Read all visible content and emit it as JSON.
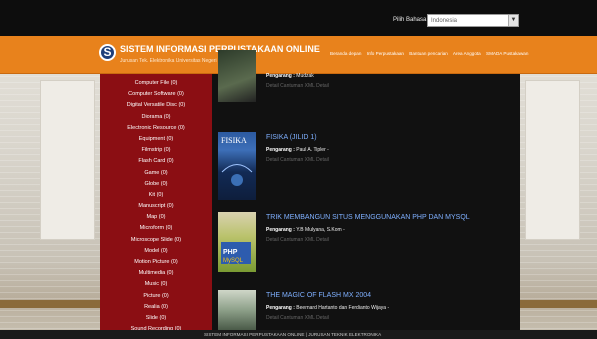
{
  "topbar": {
    "language_label": "Pilih Bahasa",
    "language_value": "Indonesia"
  },
  "header": {
    "title": "SISTEM INFORMASI PERPUSTAKAAN ONLINE",
    "subtitle": "Jurusan Tek. Elektronika Universitas Negeri Makassar",
    "nav": [
      "Beranda depan",
      "Info Perpustakaan",
      "Bantuan pencarian",
      "Area Anggota",
      "SMADA Pustakawan"
    ]
  },
  "sidebar": {
    "items": [
      "Computer File (0)",
      "Computer Software (0)",
      "Digital Versatile Disc (0)",
      "Diorama (0)",
      "Electronic Resource (0)",
      "Equipment (0)",
      "Filmstrip (0)",
      "Flash Card (0)",
      "Game (0)",
      "Globe (0)",
      "Kit (0)",
      "Manuscript (0)",
      "Map (0)",
      "Microform (0)",
      "Microscope Slide (0)",
      "Model (0)",
      "Motion Picture (0)",
      "Multimedia (0)",
      "Music (0)",
      "Picture (0)",
      "Realia (0)",
      "Slide (0)",
      "Sound Recording (0)"
    ]
  },
  "books": [
    {
      "title": "",
      "author_label": "Pengarang :",
      "author": "Mudzak",
      "detail": "Detail Cantuman XML Detail"
    },
    {
      "title": "FISIKA (JILID 1)",
      "author_label": "Pengarang :",
      "author": "Paul A. Tipler -",
      "detail": "Detail Cantuman XML Detail"
    },
    {
      "title": "TRIK MEMBANGUN SITUS MENGGUNAKAN PHP DAN MYSQL",
      "author_label": "Pengarang :",
      "author": "Y.B Mulyana, S.Kom -",
      "detail": "Detail Cantuman XML Detail"
    },
    {
      "title": "THE MAGIC OF FLASH MX 2004",
      "author_label": "Pengarang :",
      "author": "Beernard Hartanto dan Ferdianto Wijaya -",
      "detail": "Detail Cantuman XML Detail"
    }
  ],
  "footer": {
    "text": "SISTEM INFORMASI PERPUSTAKAAN ONLINE  |  JURUSAN TEKNIK ELEKTRONIKA"
  },
  "colors": {
    "header": "#e8821c",
    "sidebar": "#8b0e13",
    "link": "#7fb0ff"
  }
}
